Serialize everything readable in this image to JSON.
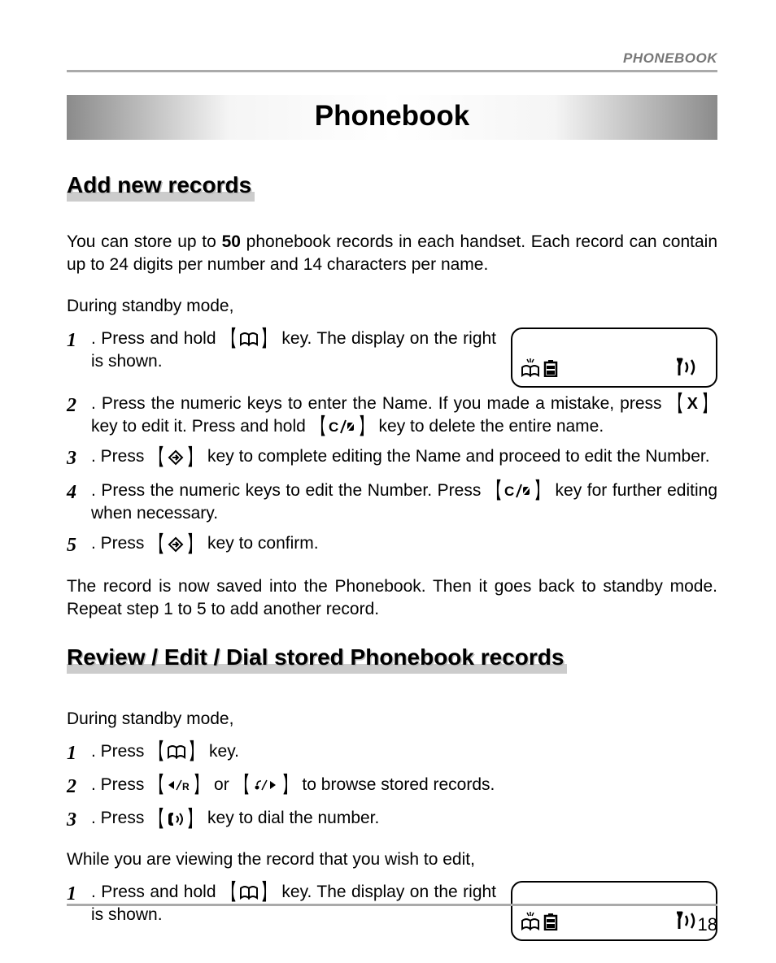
{
  "header": "PHONEBOOK",
  "title": "Phonebook",
  "section1": {
    "heading": "Add new records",
    "intro_a": "You can store up to ",
    "intro_b_bold": "50",
    "intro_c": " phonebook records in each handset. Each record can contain up to 24 digits per number and 14 characters per name.",
    "standby": "During standby mode,",
    "steps": {
      "n1": "1",
      "n2": "2",
      "n3": "3",
      "n4": "4",
      "n5": "5",
      "s1a": ". Press and hold ",
      "s1b": " key. The display on the right is shown.",
      "s2a": ". Press the numeric keys to enter the Name. If you made a mistake, press ",
      "s2b": " key to edit it. Press and hold ",
      "s2c": " key to delete the entire name.",
      "s3a": ". Press ",
      "s3b": " key to complete editing the Name and proceed to edit the Number.",
      "s4a": ". Press the numeric keys to edit the Number. Press ",
      "s4b": " key for further editing when necessary.",
      "s5a": ". Press ",
      "s5b": " key to confirm."
    },
    "outro": "The record is now saved into the Phonebook. Then it goes back to standby mode. Repeat step 1 to 5 to add another record."
  },
  "section2": {
    "heading": "Review / Edit / Dial stored Phonebook records",
    "standby": "During standby mode,",
    "steps": {
      "n1": "1",
      "n2": "2",
      "n3": "3",
      "s1a": ". Press ",
      "s1b": " key.",
      "s2a": ". Press ",
      "s2b": " or ",
      "s2c": " to browse stored records.",
      "s3a": ". Press ",
      "s3b": " key to dial the number."
    },
    "viewing": "While you are viewing the record that you wish to edit,",
    "edit_n1": "1",
    "edit_s1a": ". Press and hold ",
    "edit_s1b": " key. The display on the right is shown."
  },
  "keys": {
    "x": "X"
  },
  "page_number": "18"
}
